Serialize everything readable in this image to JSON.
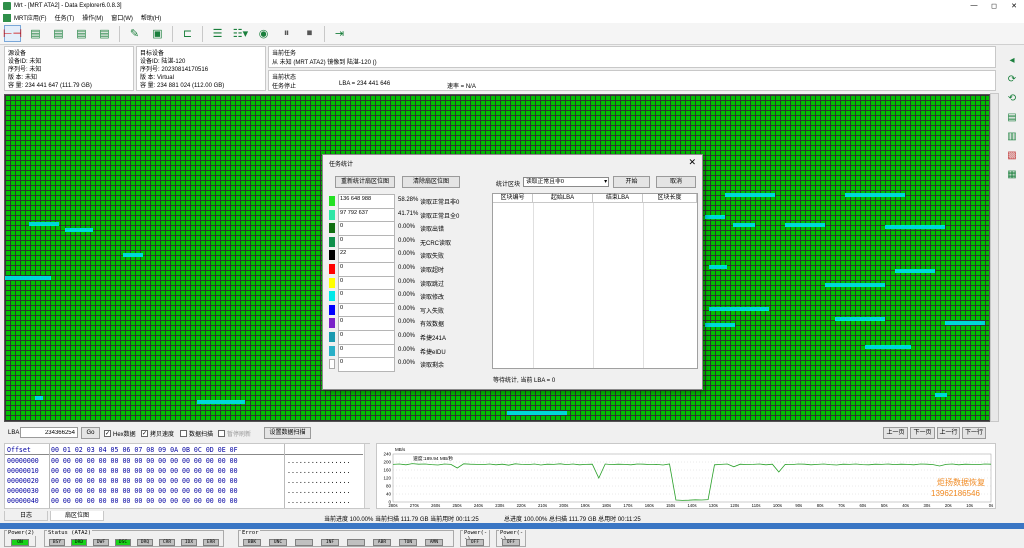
{
  "app": {
    "title": "Mrt - [MRT ATA2] - Data Explorer6.0.8.3]",
    "window_controls": [
      "—",
      "◻",
      "✕"
    ]
  },
  "menu": [
    "MRT应用(F)",
    "任务(T)",
    "操作(M)",
    "窗口(W)",
    "帮助(H)"
  ],
  "toolbar": {
    "icons": [
      "hdd-copy-icon",
      "doc-icon",
      "doc-icon",
      "doc-icon",
      "doc-icon",
      "edit-icon",
      "save-icon",
      "tree-icon",
      "list-icon",
      "list-dropdown-icon",
      "disk-icon",
      "pause-icon",
      "stop-icon",
      "exit-icon"
    ]
  },
  "source": {
    "header": "源设备",
    "id": "设备ID: 未知",
    "serial": "序列号: 未知",
    "version": "版    本: 未知",
    "capacity": "容    量: 234 441 647 (111.79 GB)"
  },
  "target": {
    "header": "目标设备",
    "id": "设备ID: 陆湛-120",
    "serial": "序列号: 20230814170516",
    "version": "版    本: Virtual",
    "capacity": "容    量: 234 881 024 (112.00 GB)"
  },
  "task": {
    "header": "当前任务",
    "text": "从 未知 (MRT ATA2) 镜像到 陆湛-120 ()",
    "status_header": "当前状态",
    "status": "任务停止",
    "lba": "LBA = 234 441 646",
    "speed": "速率 = N/A"
  },
  "sidebar": {
    "icons": [
      "nav-icon",
      "refresh-icon",
      "refresh-icon",
      "doc-icon",
      "doc-icon",
      "report-icon",
      "doc-icon"
    ]
  },
  "lba_bar": {
    "label": "LBA",
    "value": "234366254",
    "go": "Go",
    "hex_label": "Hex数据",
    "copy_speed_label": "拷贝速度",
    "data_scan_label": "数据扫描",
    "pause_refresh_label": "暂停刷新",
    "set_scan_label": "设置数据扫描",
    "nav": [
      "上一页",
      "下一页",
      "上一行",
      "下一行"
    ]
  },
  "hex": {
    "header_offset": "Offset",
    "header_cols": "00 01 02 03 04 05 06 07 08 09 0A 0B 0C 0D 0E 0F",
    "rows": [
      {
        "offset": "00000000",
        "bytes": "00 00 00 00 00 00 00 00 00 00 00 00 00 00 00 00",
        "ascii": "................"
      },
      {
        "offset": "00000010",
        "bytes": "00 00 00 00 00 00 00 00 00 00 00 00 00 00 00 00",
        "ascii": "................"
      },
      {
        "offset": "00000020",
        "bytes": "00 00 00 00 00 00 00 00 00 00 00 00 00 00 00 00",
        "ascii": "................"
      },
      {
        "offset": "00000030",
        "bytes": "00 00 00 00 00 00 00 00 00 00 00 00 00 00 00 00",
        "ascii": "................"
      },
      {
        "offset": "00000040",
        "bytes": "00 00 00 00 00 00 00 00 00 00 00 00 00 00 00 00",
        "ascii": "................"
      }
    ]
  },
  "speed_chart": {
    "unit": "MB/s",
    "current": "速度:189.94 MB/秒",
    "y_ticks": [
      "240",
      "200",
      "160",
      "120",
      "80",
      "40",
      "0"
    ],
    "x_ticks": [
      "280s",
      "270s",
      "260s",
      "250s",
      "240s",
      "230s",
      "220s",
      "210s",
      "200s",
      "190s",
      "180s",
      "170s",
      "160s",
      "150s",
      "140s",
      "130s",
      "120s",
      "110s",
      "100s",
      "90s",
      "80s",
      "70s",
      "60s",
      "50s",
      "40s",
      "30s",
      "20s",
      "10s",
      "0s"
    ],
    "series": [
      188,
      190,
      186,
      192,
      189,
      190,
      187,
      185,
      190,
      188,
      170,
      191,
      189,
      188,
      187,
      190,
      186,
      189,
      184,
      191,
      188,
      187,
      190,
      185,
      189,
      188,
      191,
      187,
      190,
      186,
      188,
      189,
      120,
      190,
      187,
      189,
      188,
      186,
      190,
      189,
      187,
      188,
      185,
      190,
      10,
      8,
      9,
      11,
      10,
      12,
      186,
      188,
      190,
      176,
      189,
      187,
      188,
      190,
      186,
      189,
      150,
      188,
      187,
      190,
      189,
      186,
      188,
      190,
      187,
      185,
      189,
      188,
      190,
      187,
      186,
      189,
      188,
      190,
      187,
      189,
      188,
      186,
      190,
      189,
      187,
      180,
      188,
      190,
      186,
      189,
      188,
      187,
      190,
      189
    ]
  },
  "watermark": {
    "line1": "炬扬数据恢复",
    "line2": "13962186546"
  },
  "tabs": [
    "日志",
    "扇区位图"
  ],
  "progress": {
    "current": "当前进度 100.00% 当前扫描 111.79 GB 当前用时 00:11:25",
    "total": "总进度 100.00% 总扫描 111.79 GB 总用时 00:11:25"
  },
  "bottom": {
    "power2_label": "Power(2)",
    "power2_state": "ON",
    "status_label": "Status (ATA2)",
    "status_regs": [
      {
        "name": "BSY",
        "on": false
      },
      {
        "name": "DRD",
        "on": true
      },
      {
        "name": "DWF",
        "on": false
      },
      {
        "name": "DSC",
        "on": true
      },
      {
        "name": "DRQ",
        "on": false
      },
      {
        "name": "CRR",
        "on": false
      },
      {
        "name": "IDX",
        "on": false
      },
      {
        "name": "ERR",
        "on": false
      }
    ],
    "error_label": "Error",
    "error_regs": [
      "BBK",
      "UNC",
      "",
      "INF",
      "",
      "ABR",
      "TON",
      "AMN"
    ],
    "power3_label": "Power(--)",
    "power3_state": "OFF",
    "power4_label": "Power(--)",
    "power4_state": "OFF"
  },
  "dialog": {
    "title": "任务统计",
    "redraw": "重新统计扇区位图",
    "clear": "清除扇区位图",
    "block_label": "统计区块",
    "block_selected": "读取正常且非0",
    "start": "开始",
    "cancel": "取消",
    "table_headers": [
      "区块编号",
      "起始LBA",
      "结束LBA",
      "区块长度"
    ],
    "footer": "等待统计, 当前 LBA = 0",
    "stats": [
      {
        "color": "#22e022",
        "count": "136 648 988",
        "pct": "58.28%",
        "label": "读取正常且非0"
      },
      {
        "color": "#2ee6a6",
        "count": "97 792 637",
        "pct": "41.71%",
        "label": "读取正常且全0"
      },
      {
        "color": "#106e10",
        "count": "0",
        "pct": "0.00%",
        "label": "读取出错"
      },
      {
        "color": "#0f8f4a",
        "count": "0",
        "pct": "0.00%",
        "label": "无CRC读取"
      },
      {
        "color": "#000000",
        "count": "22",
        "pct": "0.00%",
        "label": "读取失败"
      },
      {
        "color": "#ff0000",
        "count": "0",
        "pct": "0.00%",
        "label": "读取超时"
      },
      {
        "color": "#ffff00",
        "count": "0",
        "pct": "0.00%",
        "label": "读取跳过"
      },
      {
        "color": "#00e8e8",
        "count": "0",
        "pct": "0.00%",
        "label": "读取修改"
      },
      {
        "color": "#0000ff",
        "count": "0",
        "pct": "0.00%",
        "label": "写入失败"
      },
      {
        "color": "#7a22c8",
        "count": "0",
        "pct": "0.00%",
        "label": "有效数据"
      },
      {
        "color": "#1a9ab0",
        "count": "0",
        "pct": "0.00%",
        "label": "希捷241A"
      },
      {
        "color": "#2ab0c8",
        "count": "0",
        "pct": "0.00%",
        "label": "希捷eIDU"
      },
      {
        "color": "#ffffff",
        "count": "0",
        "pct": "0.00%",
        "label": "读取剩余"
      }
    ]
  }
}
